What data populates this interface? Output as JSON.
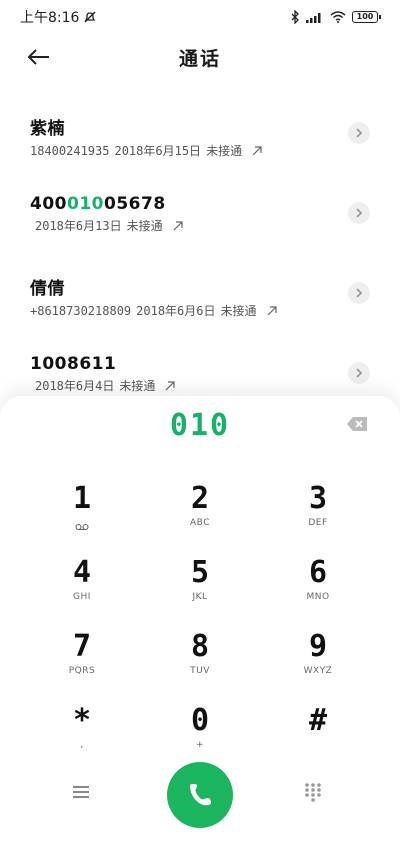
{
  "status_bar": {
    "time": "上午8:16",
    "battery": "100"
  },
  "header": {
    "title": "通话"
  },
  "calls": [
    {
      "name_pre": "紫楠",
      "name_hl": "",
      "name_post": "",
      "number": "18400241935",
      "date": "2018年6月15日",
      "status": "未接通"
    },
    {
      "name_pre": "400",
      "name_hl": "010",
      "name_post": "05678",
      "number": "",
      "date": "2018年6月13日",
      "status": "未接通"
    },
    {
      "name_pre": "倩倩",
      "name_hl": "",
      "name_post": "",
      "number": "+8618730218809",
      "date": "2018年6月6日",
      "status": "未接通"
    },
    {
      "name_pre": "1008611",
      "name_hl": "",
      "name_post": "",
      "number": "",
      "date": "2018年6月4日",
      "status": "未接通"
    }
  ],
  "dialpad": {
    "input": "010",
    "keys": [
      {
        "digit": "1",
        "letters": ""
      },
      {
        "digit": "2",
        "letters": "ABC"
      },
      {
        "digit": "3",
        "letters": "DEF"
      },
      {
        "digit": "4",
        "letters": "GHI"
      },
      {
        "digit": "5",
        "letters": "JKL"
      },
      {
        "digit": "6",
        "letters": "MNO"
      },
      {
        "digit": "7",
        "letters": "PQRS"
      },
      {
        "digit": "8",
        "letters": "TUV"
      },
      {
        "digit": "9",
        "letters": "WXYZ"
      },
      {
        "digit": "*",
        "letters": ","
      },
      {
        "digit": "0",
        "letters": "+"
      },
      {
        "digit": "#",
        "letters": ""
      }
    ]
  },
  "colors": {
    "accent": "#17b26a",
    "call_button": "#1cb55f"
  },
  "icons": {
    "back": "arrow-left-icon",
    "outgoing": "arrow-up-right-icon",
    "detail": "chevron-right-icon",
    "backspace": "backspace-icon",
    "voicemail": "voicemail-icon",
    "menu": "hamburger-menu-icon",
    "call": "phone-icon",
    "dialpad": "dialpad-grid-icon"
  }
}
